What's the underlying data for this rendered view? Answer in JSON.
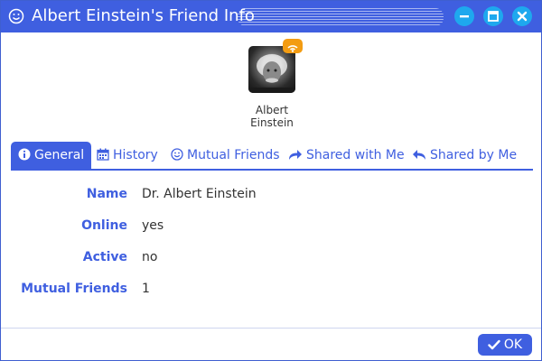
{
  "window": {
    "title": "Albert Einstein's Friend Info",
    "accent_color": "#3f5fe0",
    "button_color": "#1ea8ee",
    "title_icon": "smiley-icon",
    "controls": [
      "minimize-icon",
      "maximize-icon",
      "close-icon"
    ]
  },
  "profile": {
    "first_name": "Albert",
    "last_name": "Einstein",
    "badge_icon": "feed-icon",
    "badge_color": "#f39c12"
  },
  "tabs": [
    {
      "label": "General",
      "icon": "info-circle-icon",
      "active": true
    },
    {
      "label": "History",
      "icon": "calendar-icon",
      "active": false
    },
    {
      "label": "Mutual Friends",
      "icon": "smiley-icon",
      "active": false
    },
    {
      "label": "Shared with Me",
      "icon": "share-arrow-icon",
      "active": false
    },
    {
      "label": "Shared by Me",
      "icon": "reply-arrow-icon",
      "active": false
    }
  ],
  "general": [
    {
      "label": "Name",
      "value": "Dr. Albert Einstein"
    },
    {
      "label": "Online",
      "value": "yes"
    },
    {
      "label": "Active",
      "value": "no"
    },
    {
      "label": "Mutual Friends",
      "value": "1"
    }
  ],
  "footer": {
    "ok_label": "OK",
    "ok_icon": "checkmark-icon"
  }
}
